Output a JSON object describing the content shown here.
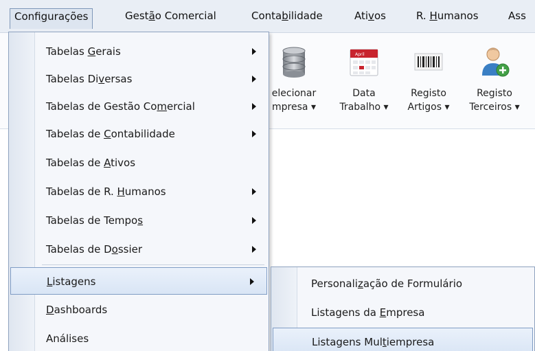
{
  "menubar": {
    "items": [
      {
        "pre": "Confi",
        "acc": "g",
        "post": "urações"
      },
      {
        "pre": "Gest",
        "acc": "ã",
        "post": "o Comercial"
      },
      {
        "pre": "Conta",
        "acc": "b",
        "post": "ilidade"
      },
      {
        "pre": "Ati",
        "acc": "v",
        "post": "os"
      },
      {
        "pre": "R. ",
        "acc": "H",
        "post": "umanos"
      },
      {
        "pre": "Ass",
        "acc": "",
        "post": ""
      }
    ]
  },
  "toolbar": {
    "buttons": [
      {
        "line1": "elecionar",
        "line2": "mpresa ▾",
        "icon": "database-icon"
      },
      {
        "line1": "Data",
        "line2": "Trabalho ▾",
        "icon": "calendar-icon"
      },
      {
        "line1": "Registo",
        "line2": "Artigos ▾",
        "icon": "barcode-icon"
      },
      {
        "line1": "Registo",
        "line2": "Terceiros ▾",
        "icon": "add-user-icon"
      }
    ],
    "calendar_text": "April"
  },
  "dropdown": {
    "items": [
      {
        "pre": "Tabelas ",
        "acc": "G",
        "post": "erais",
        "submenu": true
      },
      {
        "pre": "Tabelas Di",
        "acc": "v",
        "post": "ersas",
        "submenu": true
      },
      {
        "pre": "Tabelas de Gestão Co",
        "acc": "m",
        "post": "ercial",
        "submenu": true
      },
      {
        "pre": "Tabelas de ",
        "acc": "C",
        "post": "ontabilidade",
        "submenu": true
      },
      {
        "pre": "Tabelas de ",
        "acc": "A",
        "post": "tivos",
        "submenu": false
      },
      {
        "pre": "Tabelas de R. ",
        "acc": "H",
        "post": "umanos",
        "submenu": true
      },
      {
        "pre": "Tabelas de Tempo",
        "acc": "s",
        "post": "",
        "submenu": true
      },
      {
        "pre": "Tabelas de D",
        "acc": "o",
        "post": "ssier",
        "submenu": true
      },
      {
        "pre": "",
        "acc": "L",
        "post": "istagens",
        "submenu": true
      },
      {
        "pre": "",
        "acc": "D",
        "post": "ashboards",
        "submenu": false
      },
      {
        "pre": "Análises",
        "acc": "",
        "post": "",
        "submenu": false
      }
    ]
  },
  "submenu": {
    "items": [
      {
        "pre": "Personali",
        "acc": "z",
        "post": "ação de Formulário"
      },
      {
        "pre": "Listagens da ",
        "acc": "E",
        "post": "mpresa"
      },
      {
        "pre": "Listagens Mul",
        "acc": "t",
        "post": "iempresa"
      }
    ]
  },
  "colors": {
    "accent_border": "#7f9cc4",
    "menu_bg": "#f5f7fb"
  }
}
